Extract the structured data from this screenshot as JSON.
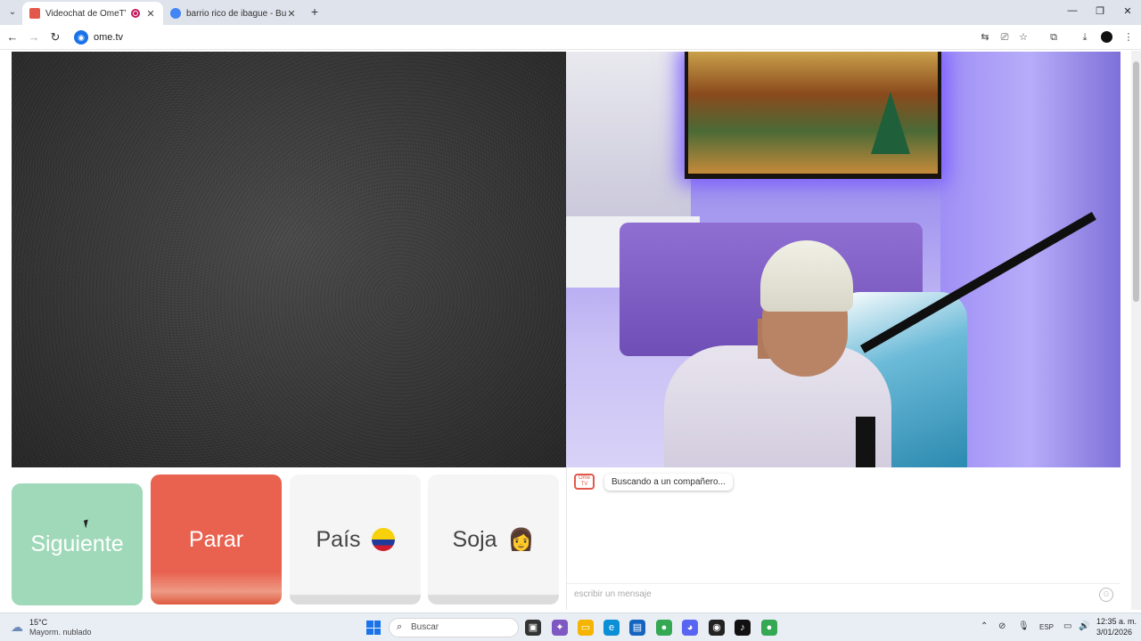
{
  "browser": {
    "tabs": [
      {
        "title": "Videochat de OmeTV: una",
        "active": true,
        "favicon_color": "#e2584b"
      },
      {
        "title": "barrio rico de ibague - Buscar c",
        "active": false,
        "favicon_color": "#4285f4"
      }
    ],
    "new_tab": "+",
    "window_controls": {
      "minimize": "—",
      "restore": "❐",
      "close": "✕"
    },
    "nav": {
      "back": "←",
      "forward": "→",
      "reload": "↻"
    },
    "url": "ome.tv"
  },
  "page": {
    "buttons": {
      "next": "Siguiente",
      "stop": "Parar",
      "country": "País",
      "gender": "Soja",
      "gender_emoji": "👩"
    },
    "chat": {
      "logo": "Ome TV",
      "status_message": "Buscando a un compañero...",
      "input_placeholder": "escribir un mensaje"
    },
    "colors": {
      "next": "#9fd9b9",
      "stop": "#e8624f",
      "neutral": "#f5f5f5"
    }
  },
  "taskbar": {
    "weather_temp": "15°C",
    "weather_desc": "Mayorm. nublado",
    "search_placeholder": "Buscar",
    "language": "ESP",
    "time": "12:35 a. m.",
    "date": "3/01/2026"
  }
}
